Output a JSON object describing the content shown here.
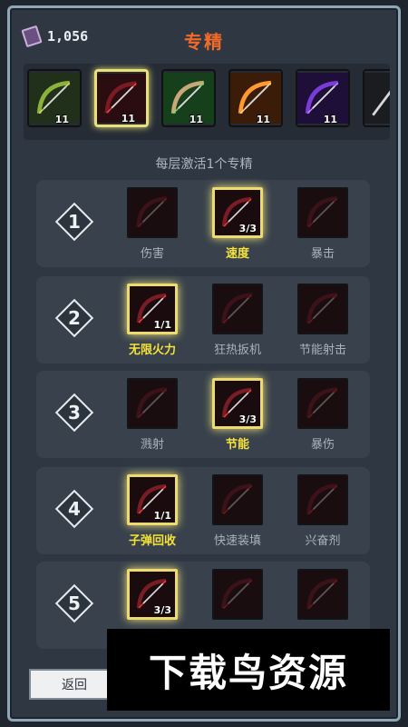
{
  "header": {
    "currency_value": "1,056",
    "title": "专精"
  },
  "weapons": [
    {
      "level": "11",
      "icon": "bow-green-icon",
      "selected": false
    },
    {
      "level": "11",
      "icon": "bow-red-icon",
      "selected": true
    },
    {
      "level": "11",
      "icon": "crossbow-green-icon",
      "selected": false
    },
    {
      "level": "11",
      "icon": "arrow-fire-icon",
      "selected": false
    },
    {
      "level": "11",
      "icon": "crossbow-purple-icon",
      "selected": false
    }
  ],
  "subtitle": "每层激活1个专精",
  "tiers": [
    {
      "number": "1",
      "skills": [
        {
          "name": "伤害",
          "active": false,
          "count": ""
        },
        {
          "name": "速度",
          "active": true,
          "count": "3/3"
        },
        {
          "name": "暴击",
          "active": false,
          "count": ""
        }
      ]
    },
    {
      "number": "2",
      "skills": [
        {
          "name": "无限火力",
          "active": true,
          "count": "1/1"
        },
        {
          "name": "狂热扳机",
          "active": false,
          "count": ""
        },
        {
          "name": "节能射击",
          "active": false,
          "count": ""
        }
      ]
    },
    {
      "number": "3",
      "skills": [
        {
          "name": "溅射",
          "active": false,
          "count": ""
        },
        {
          "name": "节能",
          "active": true,
          "count": "3/3"
        },
        {
          "name": "暴伤",
          "active": false,
          "count": ""
        }
      ]
    },
    {
      "number": "4",
      "skills": [
        {
          "name": "子弹回收",
          "active": true,
          "count": "1/1"
        },
        {
          "name": "快速装填",
          "active": false,
          "count": ""
        },
        {
          "name": "兴奋剂",
          "active": false,
          "count": ""
        }
      ]
    },
    {
      "number": "5",
      "skills": [
        {
          "name": "",
          "active": true,
          "count": "3/3"
        },
        {
          "name": "",
          "active": false,
          "count": ""
        },
        {
          "name": "",
          "active": false,
          "count": ""
        }
      ]
    }
  ],
  "back_label": "返回",
  "watermark": "下载鸟资源"
}
